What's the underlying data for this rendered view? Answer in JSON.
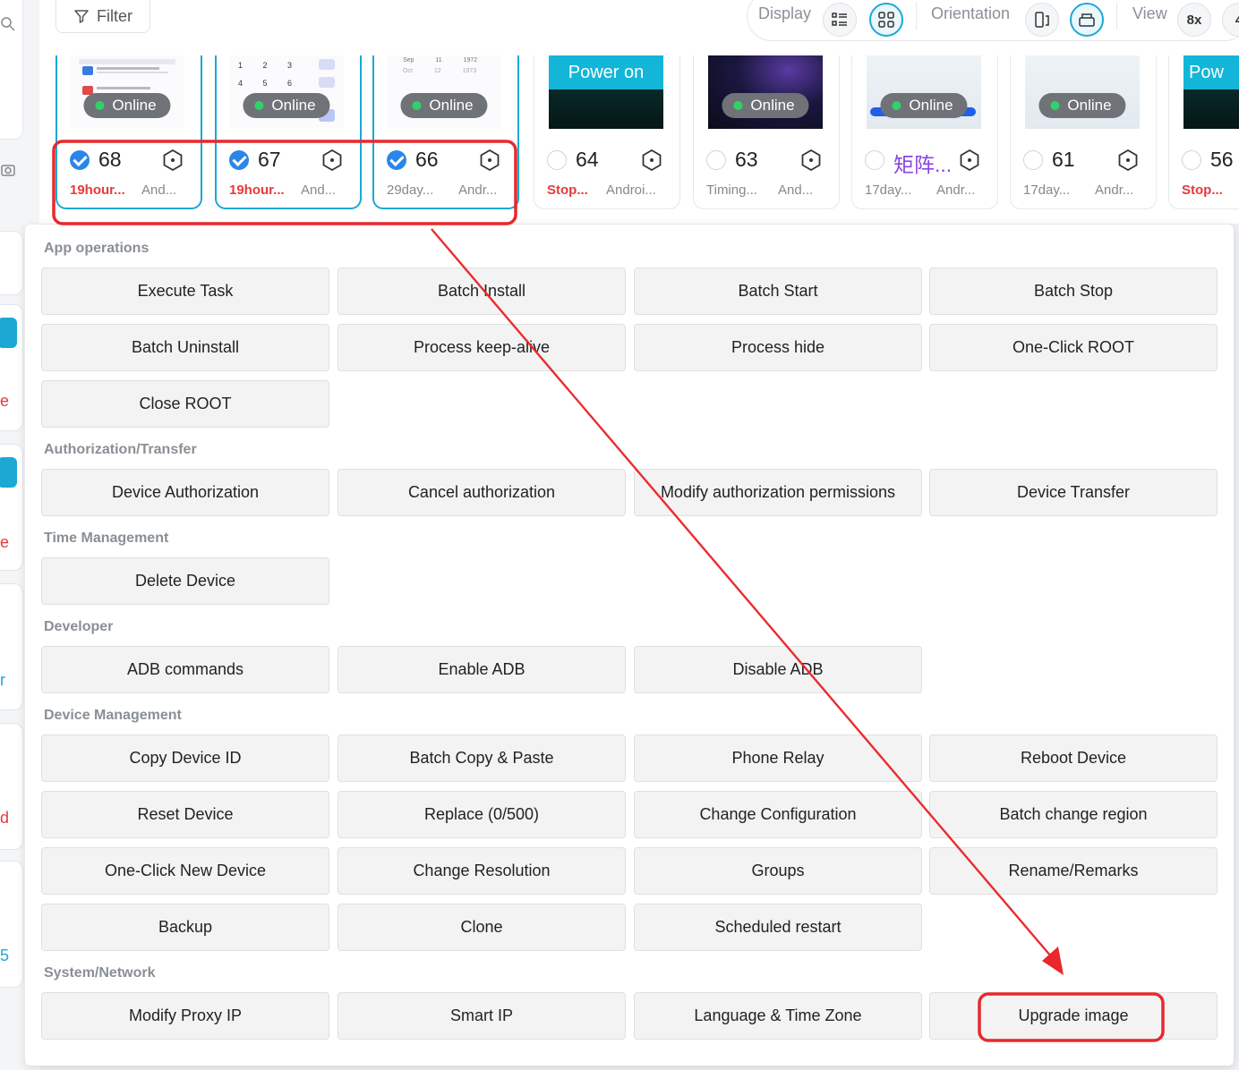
{
  "toolbar": {
    "filter_label": "Filter",
    "display_label": "Display",
    "orientation_label": "Orientation",
    "view_label": "View",
    "view_value": "8x",
    "view_next": "4"
  },
  "devices": [
    {
      "num": "68",
      "status": "Online",
      "s1": "19hour...",
      "s2": "And..."
    },
    {
      "num": "67",
      "status": "Online",
      "s1": "19hour...",
      "s2": "And..."
    },
    {
      "num": "66",
      "status": "Online",
      "s1": "29day...",
      "s2": "Andr..."
    },
    {
      "num": "64",
      "status": "Power on",
      "s1": "Stop...",
      "s2": "Androi..."
    },
    {
      "num": "63",
      "status": "Online",
      "s1": "Timing...",
      "s2": "And..."
    },
    {
      "num": "矩阵...",
      "status": "Online",
      "s1": "17day...",
      "s2": "Andr..."
    },
    {
      "num": "61",
      "status": "Online",
      "s1": "17day...",
      "s2": "Andr..."
    },
    {
      "num": "56",
      "status": "Pow",
      "s1": "Stop...",
      "s2": ""
    }
  ],
  "sections": [
    {
      "title": "App operations",
      "buttons": [
        "Execute Task",
        "Batch Install",
        "Batch Start",
        "Batch Stop",
        "Batch Uninstall",
        "Process keep-alive",
        "Process hide",
        "One-Click ROOT",
        "Close ROOT"
      ]
    },
    {
      "title": "Authorization/Transfer",
      "buttons": [
        "Device Authorization",
        "Cancel authorization",
        "Modify authorization permissions",
        "Device Transfer"
      ]
    },
    {
      "title": "Time Management",
      "buttons": [
        "Delete Device"
      ]
    },
    {
      "title": "Developer",
      "buttons": [
        "ADB commands",
        "Enable ADB",
        "Disable ADB"
      ]
    },
    {
      "title": "Device Management",
      "buttons": [
        "Copy Device ID",
        "Batch Copy & Paste",
        "Phone Relay",
        "Reboot Device",
        "Reset Device",
        "Replace (0/500)",
        "Change Configuration",
        "Batch change region",
        "One-Click New Device",
        "Change Resolution",
        "Groups",
        "Rename/Remarks",
        "Backup",
        "Clone",
        "Scheduled restart"
      ]
    },
    {
      "title": "System/Network",
      "buttons": [
        "Modify Proxy IP",
        "Smart IP",
        "Language & Time Zone",
        "Upgrade image"
      ]
    }
  ],
  "left_strip_chars": [
    "e",
    "e",
    "r",
    "d",
    "5"
  ],
  "colors": {
    "accent": "#1da8d8",
    "check": "#2b86e8",
    "annotation": "#e8282b",
    "online_dot": "#2fd36a",
    "stop_text": "#e53a3a"
  }
}
